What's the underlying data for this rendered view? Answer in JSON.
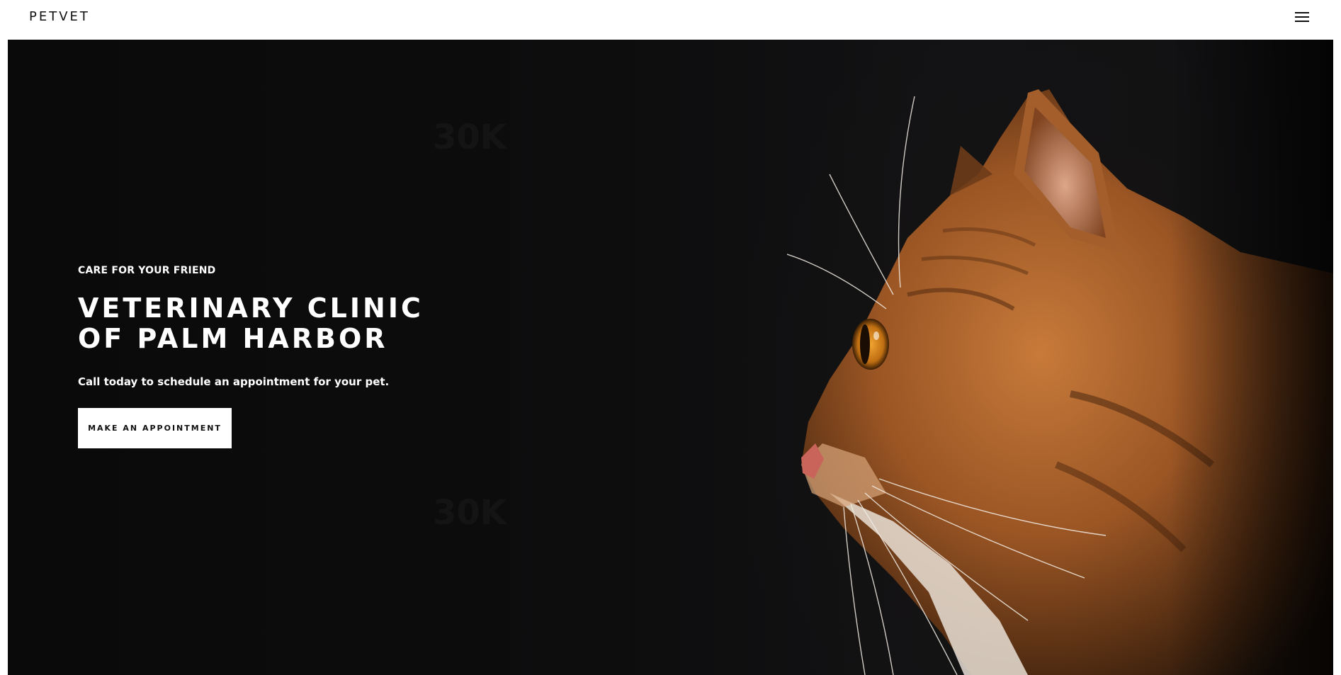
{
  "header": {
    "logo": "PETVET",
    "menu_icon": "hamburger-menu-icon"
  },
  "hero": {
    "eyebrow": "CARE FOR YOUR FRIEND",
    "title_line1": "VETERINARY CLINIC",
    "title_line2": "OF PALM HARBOR",
    "subtitle": "Call today to schedule an appointment for your pet.",
    "cta_label": "MAKE AN APPOINTMENT",
    "background_color": "#0b0b0c",
    "image_subject": "orange tabby cat in profile facing left"
  },
  "colors": {
    "header_bg": "#ffffff",
    "hero_text": "#ffffff",
    "button_bg": "#ffffff",
    "button_text": "#111111",
    "cat_fur": "#b5642a"
  }
}
